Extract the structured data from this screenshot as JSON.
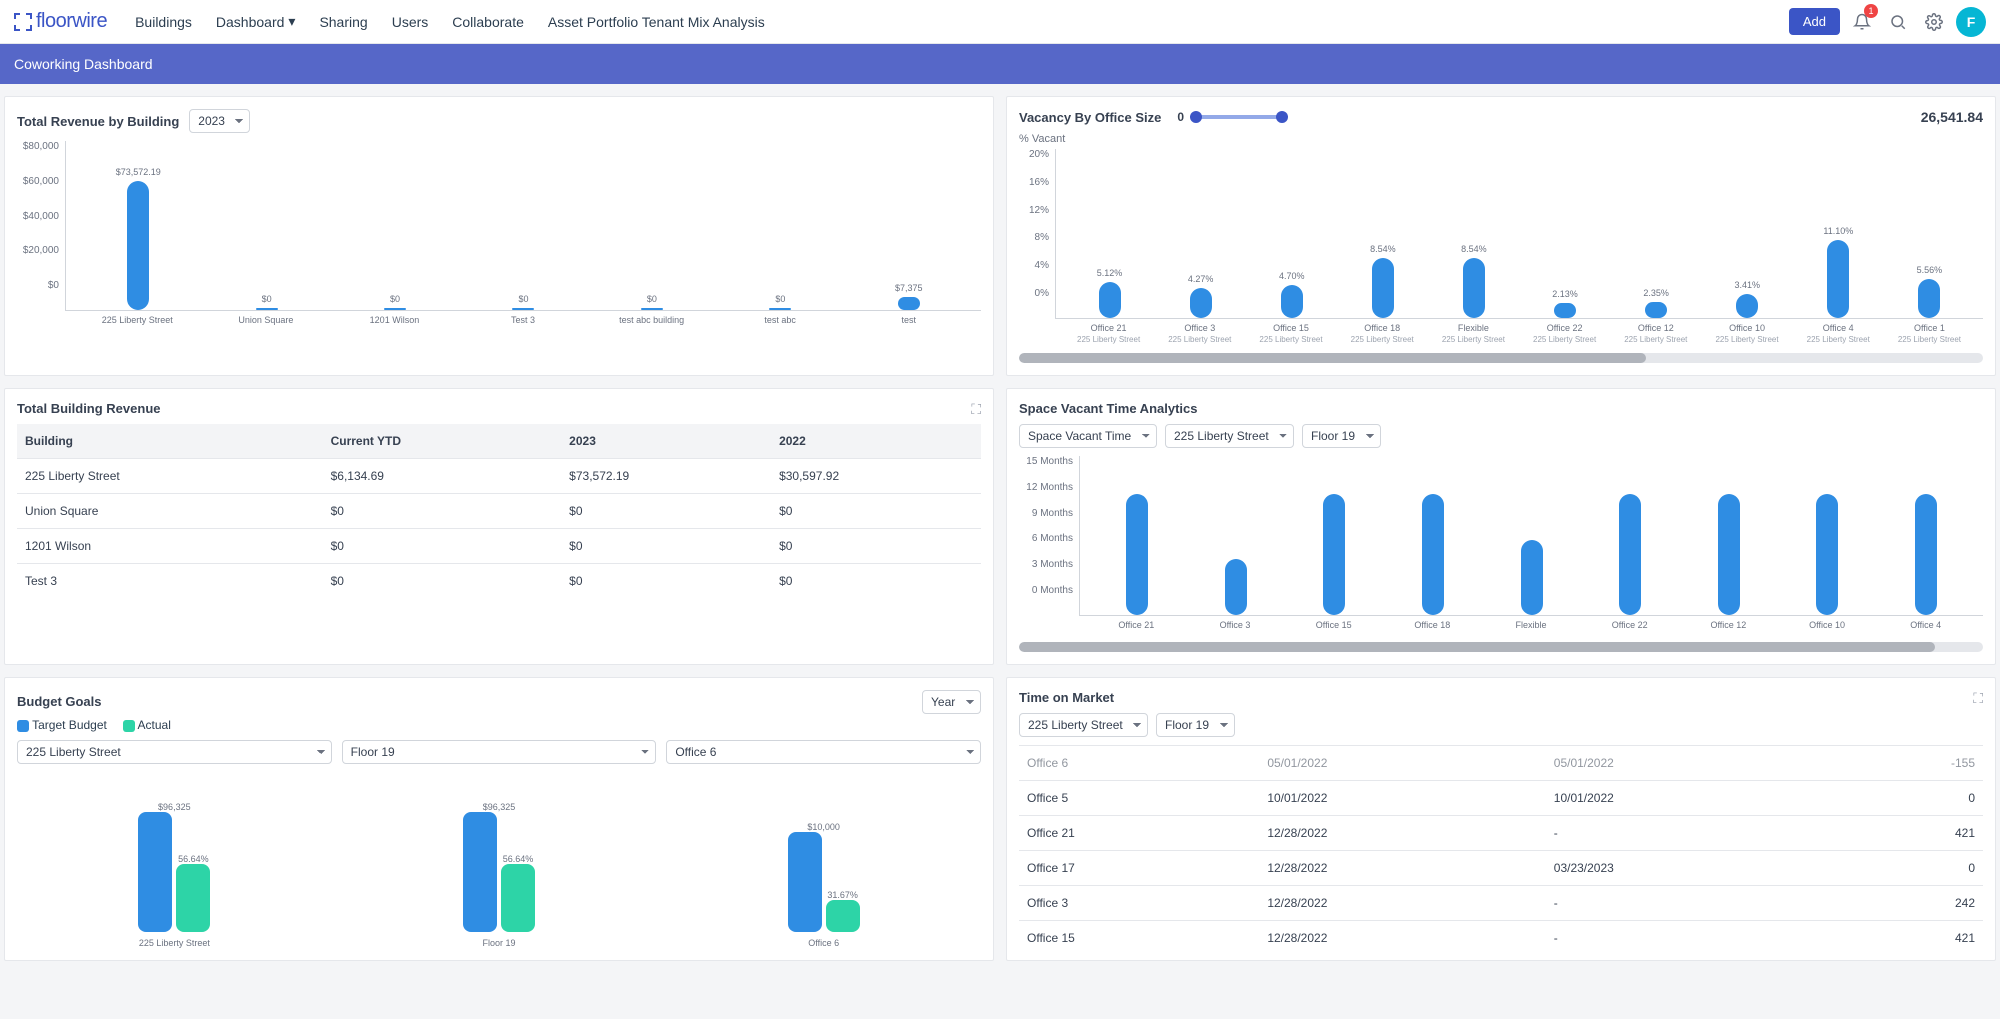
{
  "brand": {
    "text": "floorwire"
  },
  "nav": {
    "items": [
      "Buildings",
      "Dashboard",
      "Sharing",
      "Users",
      "Collaborate",
      "Asset Portfolio Tenant Mix Analysis"
    ],
    "add": "Add",
    "notif": "1",
    "avatar": "F"
  },
  "subheader": "Coworking Dashboard",
  "rev": {
    "title": "Total Revenue by Building",
    "year": "2023"
  },
  "vacancy": {
    "title": "Vacancy By Office Size",
    "pct": "% Vacant",
    "min": "0",
    "max": "26,541.84"
  },
  "building_rev": {
    "title": "Total Building Revenue",
    "cols": [
      "Building",
      "Current YTD",
      "2023",
      "2022"
    ],
    "rows": [
      [
        "225 Liberty Street",
        "$6,134.69",
        "$73,572.19",
        "$30,597.92"
      ],
      [
        "Union Square",
        "$0",
        "$0",
        "$0"
      ],
      [
        "1201 Wilson",
        "$0",
        "$0",
        "$0"
      ],
      [
        "Test 3",
        "$0",
        "$0",
        "$0"
      ]
    ]
  },
  "svt": {
    "title": "Space Vacant Time Analytics",
    "f1": "Space Vacant Time",
    "f2": "225 Liberty Street",
    "f3": "Floor 19"
  },
  "budget": {
    "title": "Budget Goals",
    "legend1": "Target Budget",
    "legend2": "Actual",
    "period": "Year",
    "m1": {
      "sel": "225 Liberty Street",
      "top": "$96,325",
      "pct": "56.64%",
      "foot": "225 Liberty Street"
    },
    "m2": {
      "sel": "Floor 19",
      "top": "$96,325",
      "pct": "56.64%",
      "foot": "Floor 19"
    },
    "m3": {
      "sel": "Office 6",
      "top": "$10,000",
      "pct": "31.67%",
      "foot": "Office 6"
    }
  },
  "tom": {
    "title": "Time on Market",
    "f1": "225 Liberty Street",
    "f2": "Floor 19",
    "rows": [
      [
        "Office 6",
        "05/01/2022",
        "05/01/2022",
        "-155"
      ],
      [
        "Office 5",
        "10/01/2022",
        "10/01/2022",
        "0"
      ],
      [
        "Office 21",
        "12/28/2022",
        "-",
        "421"
      ],
      [
        "Office 17",
        "12/28/2022",
        "03/23/2023",
        "0"
      ],
      [
        "Office 3",
        "12/28/2022",
        "-",
        "242"
      ],
      [
        "Office 15",
        "12/28/2022",
        "-",
        "421"
      ]
    ]
  },
  "chart_data": [
    {
      "id": "revenue_by_building",
      "type": "bar",
      "title": "Total Revenue by Building",
      "ylabel": "$",
      "ylim": [
        0,
        80000
      ],
      "categories": [
        "225 Liberty Street",
        "Union Square",
        "1201 Wilson",
        "Test 3",
        "test abc building",
        "test abc",
        "test"
      ],
      "values": [
        73572.19,
        0,
        0,
        0,
        0,
        0,
        7375
      ],
      "value_labels": [
        "$73,572.19",
        "$0",
        "$0",
        "$0",
        "$0",
        "$0",
        "$7,375"
      ],
      "y_ticks": [
        "$80,000",
        "$60,000",
        "$40,000",
        "$20,000",
        "$0"
      ]
    },
    {
      "id": "vacancy_by_office_size",
      "type": "bar",
      "title": "Vacancy By Office Size",
      "ylabel": "% Vacant",
      "ylim": [
        0,
        20
      ],
      "categories": [
        "Office 21",
        "Office 3",
        "Office 15",
        "Office 18",
        "Flexible",
        "Office 22",
        "Office 12",
        "Office 10",
        "Office 4",
        "Office 1"
      ],
      "sublabel": "225 Liberty Street",
      "values": [
        5.12,
        4.27,
        4.7,
        8.54,
        8.54,
        2.13,
        2.35,
        3.41,
        11.1,
        5.56
      ],
      "value_labels": [
        "5.12%",
        "4.27%",
        "4.70%",
        "8.54%",
        "8.54%",
        "2.13%",
        "2.35%",
        "3.41%",
        "11.10%",
        "5.56%"
      ],
      "y_ticks": [
        "20%",
        "16%",
        "12%",
        "8%",
        "4%",
        "0%"
      ]
    },
    {
      "id": "space_vacant_time",
      "type": "bar",
      "title": "Space Vacant Time Analytics",
      "ylabel": "Months",
      "ylim": [
        0,
        15
      ],
      "categories": [
        "Office 21",
        "Office 3",
        "Office 15",
        "Office 18",
        "Flexible",
        "Office 22",
        "Office 12",
        "Office 10",
        "Office 4"
      ],
      "values": [
        13,
        6,
        13,
        13,
        8,
        13,
        13,
        13,
        13
      ],
      "y_ticks": [
        "15 Months",
        "12 Months",
        "9 Months",
        "6 Months",
        "3 Months",
        "0 Months"
      ]
    },
    {
      "id": "budget_goals",
      "type": "bar",
      "title": "Budget Goals",
      "series_names": [
        "Target Budget",
        "Actual"
      ],
      "panels": [
        {
          "label": "225 Liberty Street",
          "target": 96325,
          "actual_pct": 56.64,
          "target_label": "$96,325",
          "actual_label": "56.64%"
        },
        {
          "label": "Floor 19",
          "target": 96325,
          "actual_pct": 56.64,
          "target_label": "$96,325",
          "actual_label": "56.64%"
        },
        {
          "label": "Office 6",
          "target": 10000,
          "actual_pct": 31.67,
          "target_label": "$10,000",
          "actual_label": "31.67%"
        }
      ]
    }
  ]
}
